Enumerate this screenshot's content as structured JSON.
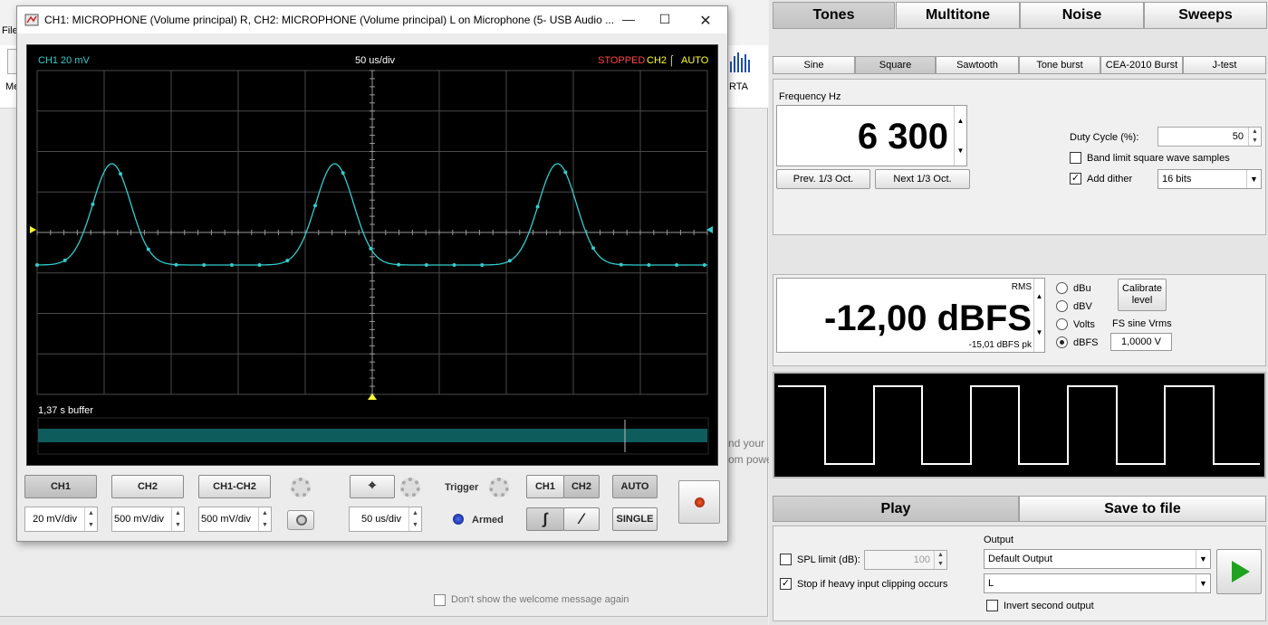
{
  "background_window": {
    "menu_file": "File",
    "toolbar_left_label": "Me",
    "rta_label": "RTA",
    "welcome_line1": "nd your",
    "welcome_line2": "om powe",
    "dont_show": "Don't show the welcome message again"
  },
  "scope": {
    "title": "CH1: MICROPHONE (Volume principal) R, CH2: MICROPHONE (Volume principal) L on Microphone (5- USB Audio ...",
    "ch1_scale": "CH1 20 mV",
    "timebase": "50 us/div",
    "status_stopped": "STOPPED",
    "status_ch2": "CH2",
    "status_slope": "⌠",
    "status_auto": "AUTO",
    "buffer_label": "1,37 s buffer",
    "ch1_button": "CH1",
    "ch2_button": "CH2",
    "ch1ch2_button": "CH1-CH2",
    "ch1_vdiv": "20 mV/div",
    "ch2_vdiv": "500 mV/div",
    "ch1ch2_vdiv": "500 mV/div",
    "timebase_value": "50 us/div",
    "trigger_label": "Trigger",
    "armed_label": "Armed",
    "trig_ch1": "CH1",
    "trig_ch2": "CH2",
    "auto_button": "AUTO",
    "single_button": "SINGLE",
    "colors": {
      "trace": "#33cccc",
      "grid": "#555555",
      "ch1": "#33cccc",
      "ch2": "#ffff33",
      "stopped": "#ff4444"
    }
  },
  "right_panel": {
    "tabs": [
      "Tones",
      "Multitone",
      "Noise",
      "Sweeps"
    ],
    "subtabs": [
      "Sine",
      "Square",
      "Sawtooth",
      "Tone burst",
      "CEA-2010 Burst",
      "J-test"
    ],
    "frequency_label": "Frequency Hz",
    "frequency_value": "6 300",
    "prev_button": "Prev. 1/3 Oct.",
    "next_button": "Next 1/3 Oct.",
    "duty_label": "Duty Cycle (%):",
    "duty_value": "50",
    "bandlimit_label": "Band limit square wave samples",
    "bandlimit_checked": false,
    "dither_label": "Add dither",
    "dither_checked": true,
    "dither_bits": "16 bits",
    "rms_label": "RMS",
    "level_value": "-12,00 dBFS",
    "peak_value": "-15,01 dBFS pk",
    "units": [
      "dBu",
      "dBV",
      "Volts",
      "dBFS"
    ],
    "unit_selected": "dBFS",
    "calibrate_line1": "Calibrate",
    "calibrate_line2": "level",
    "fs_label": "FS sine Vrms",
    "fs_value": "1,0000 V",
    "play_button": "Play",
    "save_button": "Save to file",
    "spl_label": "SPL limit (dB):",
    "spl_value": "100",
    "spl_checked": false,
    "stop_label": "Stop if heavy input clipping occurs",
    "stop_checked": true,
    "output_label": "Output",
    "output_device": "Default Output",
    "output_channel": "L",
    "invert_label": "Invert second output",
    "invert_checked": false
  }
}
